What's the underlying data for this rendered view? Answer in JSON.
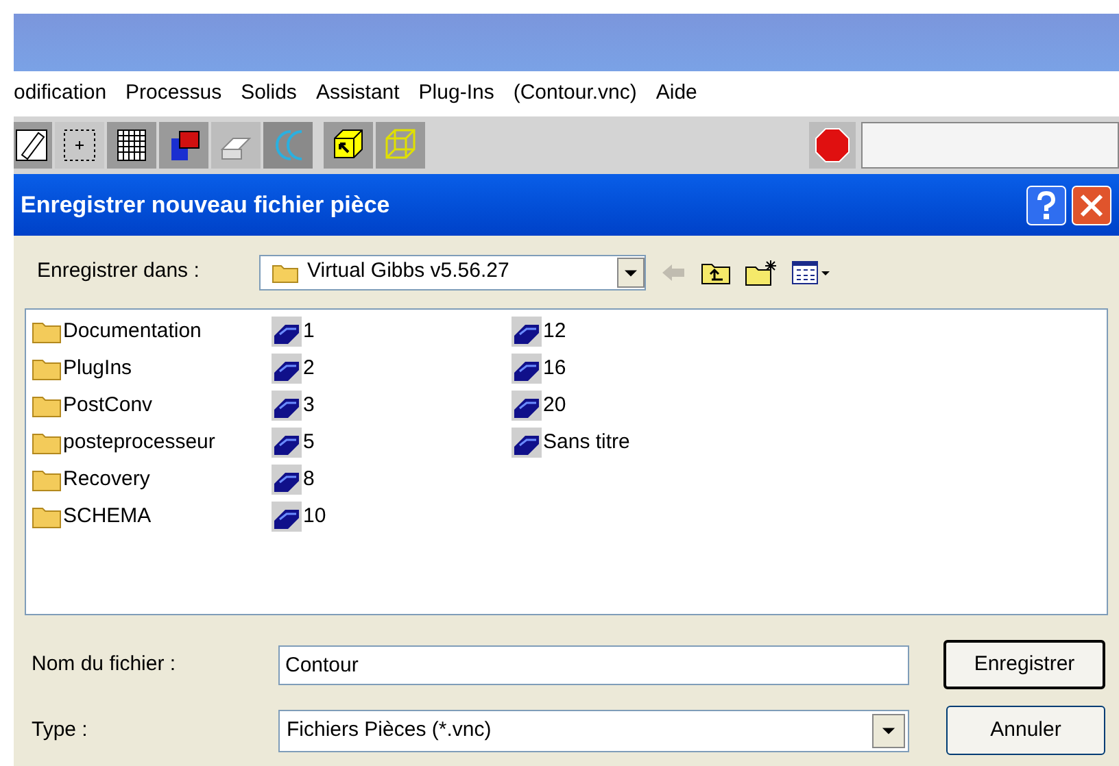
{
  "menu": [
    "odification",
    "Processus",
    "Solids",
    "Assistant",
    "Plug-Ins",
    "(Contour.vnc)",
    "Aide"
  ],
  "dialog": {
    "title": "Enregistrer nouveau fichier pièce",
    "save_in": {
      "label": "Enregistrer dans :",
      "value": "Virtual Gibbs v5.56.27"
    },
    "files": [
      {
        "kind": "folder",
        "name": "Documentation"
      },
      {
        "kind": "folder",
        "name": "PlugIns"
      },
      {
        "kind": "folder",
        "name": "PostConv"
      },
      {
        "kind": "folder",
        "name": "posteprocesseur"
      },
      {
        "kind": "folder",
        "name": "Recovery"
      },
      {
        "kind": "folder",
        "name": "SCHEMA"
      },
      {
        "kind": "file",
        "name": "1"
      },
      {
        "kind": "file",
        "name": "2"
      },
      {
        "kind": "file",
        "name": "3"
      },
      {
        "kind": "file",
        "name": "5"
      },
      {
        "kind": "file",
        "name": "8"
      },
      {
        "kind": "file",
        "name": "10"
      },
      {
        "kind": "file",
        "name": "12"
      },
      {
        "kind": "file",
        "name": "16"
      },
      {
        "kind": "file",
        "name": "20"
      },
      {
        "kind": "file",
        "name": "Sans titre"
      }
    ],
    "filename": {
      "label": "Nom du fichier :",
      "value": "Contour"
    },
    "type": {
      "label": "Type :",
      "value": "Fichiers Pièces (*.vnc)"
    },
    "buttons": [
      "Enregistrer",
      "Annuler"
    ]
  }
}
